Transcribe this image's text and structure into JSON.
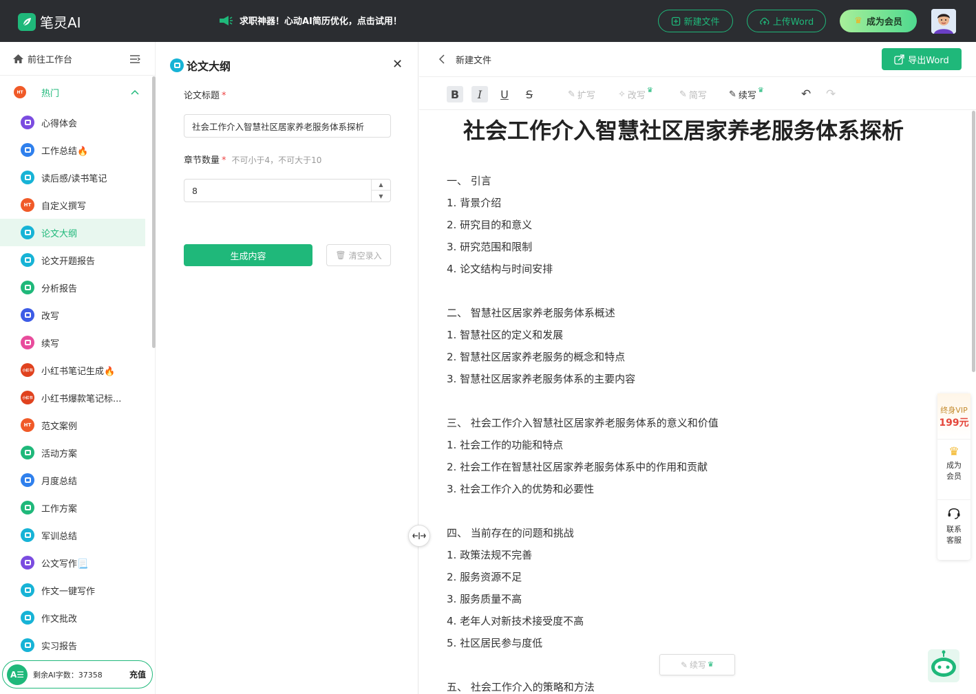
{
  "topbar": {
    "logo_text": "笔灵AI",
    "promo_text": "求职神器！心动AI简历优化，点击试用！",
    "new_file_label": "新建文件",
    "upload_word_label": "上传Word",
    "vip_label": "成为会员",
    "accent_color": "#1fb87a"
  },
  "sidebar": {
    "workbench_label": "前往工作台",
    "group_label": "热门",
    "items": [
      {
        "label": "心得体会",
        "icon": "square-icon",
        "color": "#7b4ce0"
      },
      {
        "label": "工作总结🔥",
        "icon": "briefcase-icon",
        "color": "#2f80ed"
      },
      {
        "label": "读后感/读书笔记",
        "icon": "book-icon",
        "color": "#17b3d6"
      },
      {
        "label": "自定义撰写",
        "icon": "hot-icon",
        "color": "#f05a28",
        "badge": "HT"
      },
      {
        "label": "论文大纲",
        "icon": "book-icon",
        "color": "#17b3d6",
        "active": true
      },
      {
        "label": "论文开题报告",
        "icon": "book-icon",
        "color": "#17b3d6"
      },
      {
        "label": "分析报告",
        "icon": "doc-icon",
        "color": "#1fb87a"
      },
      {
        "label": "改写",
        "icon": "pen-icon",
        "color": "#3d5ce6"
      },
      {
        "label": "续写",
        "icon": "continue-icon",
        "color": "#e84c9c"
      },
      {
        "label": "小红书笔记生成🔥",
        "icon": "xhs-icon",
        "color": "#e0421e",
        "badge": "小红书"
      },
      {
        "label": "小红书爆款笔记标...",
        "icon": "xhs-icon",
        "color": "#e0421e",
        "badge": "小红书"
      },
      {
        "label": "范文案例",
        "icon": "hot-icon",
        "color": "#f05a28",
        "badge": "HT"
      },
      {
        "label": "活动方案",
        "icon": "doc-icon",
        "color": "#1fb87a"
      },
      {
        "label": "月度总结",
        "icon": "briefcase-icon",
        "color": "#2f80ed"
      },
      {
        "label": "工作方案",
        "icon": "doc-icon",
        "color": "#1fb87a"
      },
      {
        "label": "军训总结",
        "icon": "book-icon",
        "color": "#17b3d6"
      },
      {
        "label": "公文写作📃",
        "icon": "square-icon",
        "color": "#7b4ce0"
      },
      {
        "label": "作文一键写作",
        "icon": "book-icon",
        "color": "#17b3d6"
      },
      {
        "label": "作文批改",
        "icon": "book-icon",
        "color": "#17b3d6"
      },
      {
        "label": "实习报告",
        "icon": "book-icon",
        "color": "#17b3d6"
      }
    ],
    "quota_badge": "A☰",
    "quota_text": "剩余AI字数：37358",
    "recharge_label": "充值"
  },
  "form": {
    "title": "论文大纲",
    "paper_title_label": "论文标题",
    "required_mark": "*",
    "paper_title_value": "社会工作介入智慧社区居家养老服务体系探析",
    "chapter_label": "章节数量",
    "chapter_hint": "不可小于4，不可大于10",
    "chapter_value": "8",
    "generate_label": "生成内容",
    "clear_label": "清空录入"
  },
  "editor": {
    "filename": "新建文件",
    "export_label": "导出Word",
    "toolbar": {
      "bold": "B",
      "italic": "I",
      "underline": "U",
      "strike": "S",
      "expand": "扩写",
      "rewrite": "改写",
      "simplify": "简写",
      "continue": "续写"
    },
    "doc_title": "社会工作介入智慧社区居家养老服务体系探析",
    "lines": [
      "一、 引言",
      "1. 背景介绍",
      "2. 研究目的和意义",
      "3. 研究范围和限制",
      "4. 论文结构与时间安排",
      "",
      "二、 智慧社区居家养老服务体系概述",
      "1. 智慧社区的定义和发展",
      "2. 智慧社区居家养老服务的概念和特点",
      "3. 智慧社区居家养老服务体系的主要内容",
      "",
      "三、 社会工作介入智慧社区居家养老服务体系的意义和价值",
      "1. 社会工作的功能和特点",
      "2. 社会工作在智慧社区居家养老服务体系中的作用和贡献",
      "3. 社会工作介入的优势和必要性",
      "",
      "四、 当前存在的问题和挑战",
      "1. 政策法规不完善",
      "2. 服务资源不足",
      "3. 服务质量不高",
      "4. 老年人对新技术接受度不高",
      "5. 社区居民参与度低",
      "",
      "五、 社会工作介入的策略和方法"
    ],
    "float_continue_label": "续写"
  },
  "right_float": {
    "vip_line1": "终身VIP",
    "vip_line2": "199元",
    "member_line1": "成为",
    "member_line2": "会员",
    "service_line1": "联系",
    "service_line2": "客服"
  }
}
